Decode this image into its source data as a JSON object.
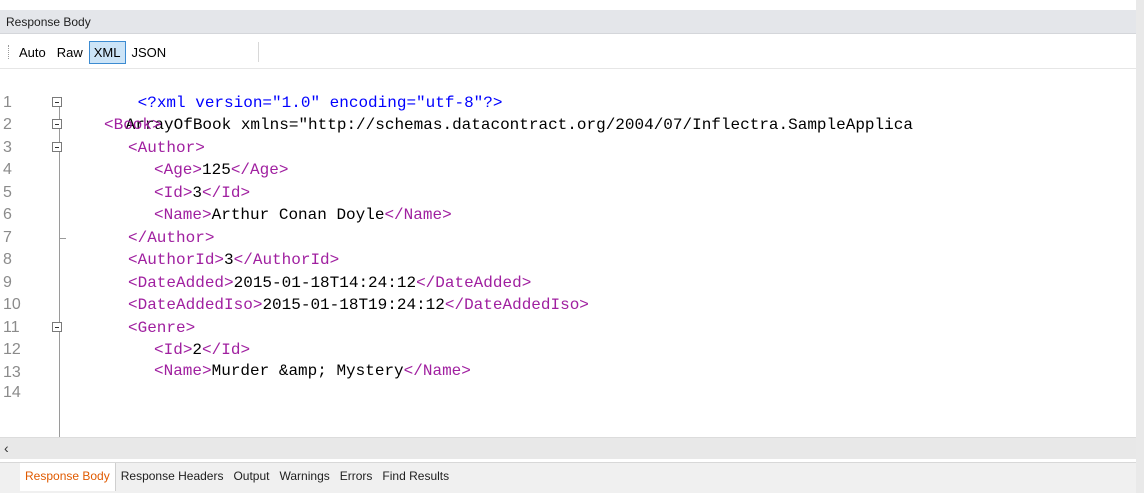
{
  "panel": {
    "title": "Response Body"
  },
  "format_tabs": [
    {
      "label": "Auto",
      "active": false
    },
    {
      "label": "Raw",
      "active": false
    },
    {
      "label": "XML",
      "active": true
    },
    {
      "label": "JSON",
      "active": false
    }
  ],
  "lines": [
    {
      "n": "1",
      "text": "<?xml version=\"1.0\" encoding=\"utf-8\"?>"
    },
    {
      "n": "2",
      "text": "<ArrayOfBook xmlns=\"http://schemas.datacontract.org/2004/07/Inflectra.SampleApplica"
    },
    {
      "n": "3",
      "text": "<Book>"
    },
    {
      "n": "4",
      "text": "<Author>"
    },
    {
      "n": "5",
      "text": "<Age>125</Age>"
    },
    {
      "n": "6",
      "text": "<Id>3</Id>"
    },
    {
      "n": "7",
      "text": "<Name>Arthur Conan Doyle</Name>"
    },
    {
      "n": "8",
      "text": "</Author>"
    },
    {
      "n": "9",
      "text": "<AuthorId>3</AuthorId>"
    },
    {
      "n": "10",
      "text": "<DateAdded>2015-01-18T14:24:12</DateAdded>"
    },
    {
      "n": "11",
      "text": "<DateAddedIso>2015-01-18T19:24:12</DateAddedIso>"
    },
    {
      "n": "12",
      "text": "<Genre>"
    },
    {
      "n": "13",
      "text": "<Id>2</Id>"
    },
    {
      "n": "14",
      "text": "<Name>Murder &amp; Mystery</Name>"
    }
  ],
  "bottom_tabs": [
    {
      "label": "Response Body",
      "active": true
    },
    {
      "label": "Response Headers",
      "active": false
    },
    {
      "label": "Output",
      "active": false
    },
    {
      "label": "Warnings",
      "active": false
    },
    {
      "label": "Errors",
      "active": false
    },
    {
      "label": "Find Results",
      "active": false
    }
  ],
  "colors": {
    "active_tab_text": "#e05a00",
    "xml_tag": "#a020a0",
    "xml_attr": "#ff0000",
    "xml_value": "#0000ff"
  }
}
